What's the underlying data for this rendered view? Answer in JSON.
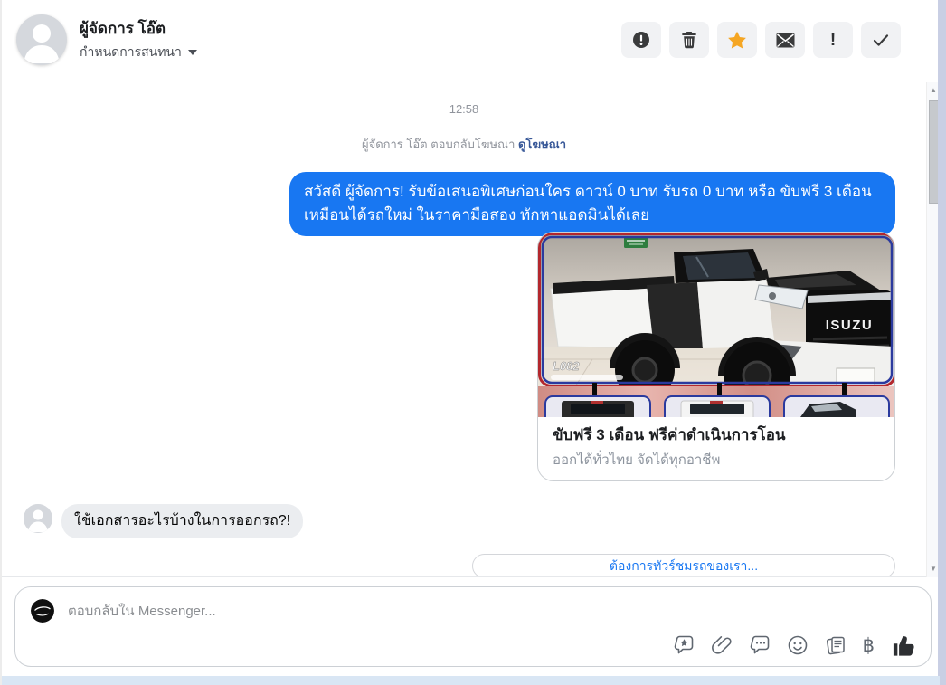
{
  "header": {
    "name": "ผู้จัดการ โอ๊ต",
    "subtitle": "กำหนดการสนทนา",
    "action_icons": [
      "report-circle-icon",
      "trash-icon",
      "star-icon",
      "mail-icon",
      "exclamation-icon",
      "check-icon"
    ],
    "star_color": "#f5a623"
  },
  "conversation": {
    "timestamp": "12:58",
    "context_text": "ผู้จัดการ โอ๊ต ตอบกลับโฆษณา",
    "context_link": "ดูโฆษณา",
    "outgoing_message": "สวัสดี ผู้จัดการ! รับข้อเสนอพิเศษก่อนใคร ดาวน์ 0 บาท รับรถ 0 บาท หรือ ขับฟรี 3 เดือน เหมือนได้รถใหม่ ในราคามือสอง ทักหาแอดมินได้เลย",
    "ad_card": {
      "brand_text": "ISUZU",
      "watermark": "L082",
      "title": "ขับฟรี 3 เดือน ฟรีค่าดำเนินการโอน",
      "subtitle": "ออกได้ทั่วไทย จัดได้ทุกอาชีพ"
    },
    "incoming_message": "ใช้เอกสารอะไรบ้างในการออกรถ?!",
    "quick_reply": "ต้องการทัวร์ชมรถของเรา..."
  },
  "composer": {
    "placeholder": "ตอบกลับใน Messenger...",
    "icons": [
      "sticker-comment-icon",
      "paperclip-icon",
      "saved-replies-icon",
      "emoji-icon",
      "notes-icon",
      "baht-payment-icon",
      "thumbs-up-icon"
    ],
    "baht_symbol": "฿"
  },
  "colors": {
    "outgoing_bubble": "#1877f2",
    "incoming_bubble": "#ebedf0",
    "context_link_blue": "#385898",
    "quick_reply_blue": "#1877f2",
    "frame_right": "#c9cfe4",
    "frame_bottom": "#d9e6f4"
  }
}
